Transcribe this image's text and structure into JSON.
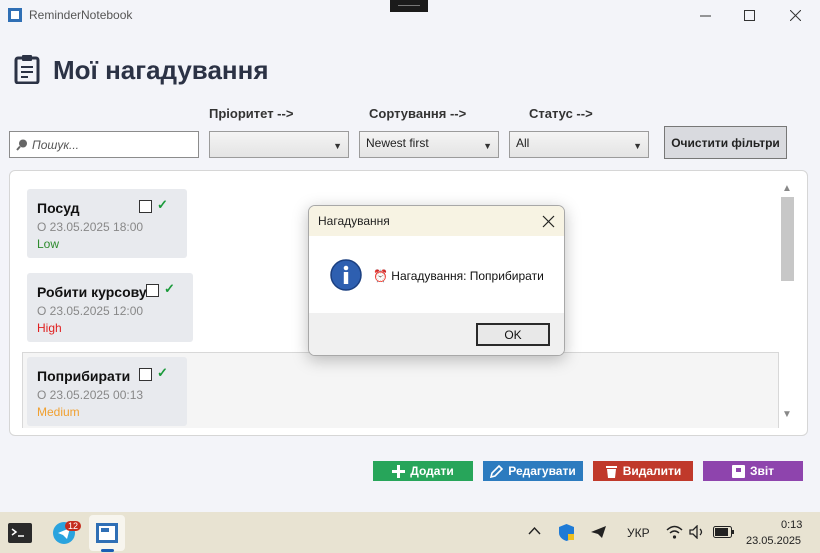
{
  "window": {
    "title": "ReminderNotebook",
    "minimize_icon": "minimize-icon",
    "maximize_icon": "maximize-icon",
    "close_icon": "close-icon"
  },
  "header": {
    "title": "Мої нагадування",
    "icon": "clipboard-icon"
  },
  "filters": {
    "priority_label": "Пріоритет -->",
    "sort_label": "Сортування -->",
    "status_label": "Статус -->",
    "search_placeholder": "Пошук...",
    "priority_value": "",
    "sort_value": "Newest first",
    "status_value": "All",
    "clear_button": "Очистити фільтри"
  },
  "reminders": [
    {
      "title": "Посуд",
      "date": "О 23.05.2025 18:00",
      "priority": "Low",
      "priority_color": "#2e8b2e"
    },
    {
      "title": "Робити курсову",
      "date": "О 23.05.2025 12:00",
      "priority": "High",
      "priority_color": "#e02020"
    },
    {
      "title": "Поприбирати",
      "date": "О 23.05.2025 00:13",
      "priority": "Medium",
      "priority_color": "#f0a030"
    }
  ],
  "actions": {
    "add": "Додати",
    "edit": "Редагувати",
    "delete": "Видалити",
    "report": "Звіт",
    "add_color": "#27a55a",
    "edit_color": "#2c7bbf",
    "delete_color": "#c0392b",
    "report_color": "#8e44ad"
  },
  "dialog": {
    "title": "Нагадування",
    "message": "⏰ Нагадування: Поприбирати",
    "ok": "OK",
    "icon": "info-icon"
  },
  "taskbar": {
    "badge": "12",
    "language": "УКР",
    "time": "0:13",
    "date": "23.05.2025"
  }
}
